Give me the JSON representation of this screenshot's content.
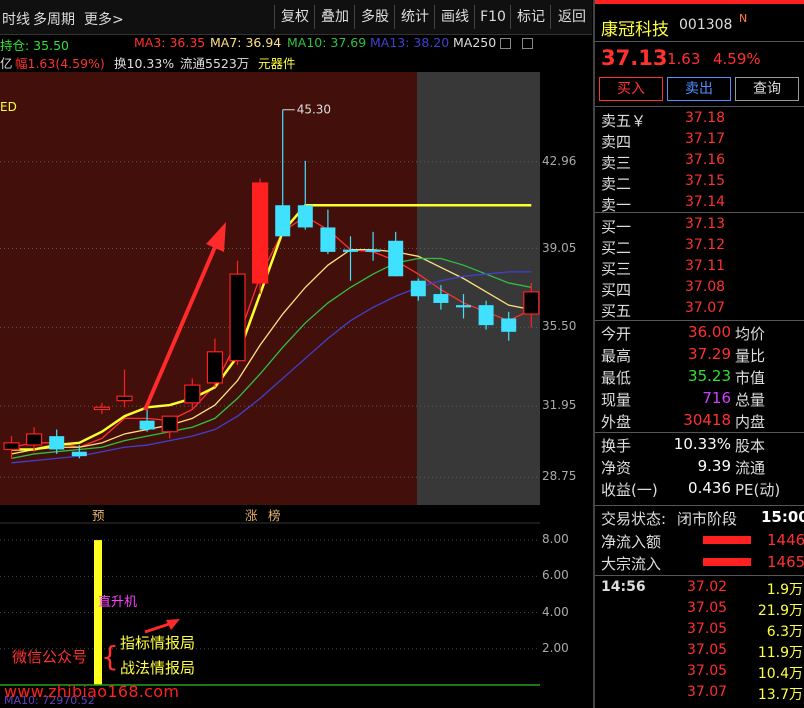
{
  "toolbar": {
    "left_items": [
      "时线",
      "多周期",
      "更多>"
    ],
    "buttons": [
      "复权",
      "叠加",
      "多股",
      "统计",
      "画线",
      "F10",
      "标记",
      "返回"
    ]
  },
  "ma_legend": {
    "hold_label": "持仓: 35.50",
    "ma3": "MA3: 36.35",
    "ma7": "MA7: 36.94",
    "ma10": "MA10: 37.69",
    "ma13": "MA13: 38.20",
    "ma250": "MA250"
  },
  "info_row": {
    "amount": "亿",
    "amplitude": "幅1.63(4.59%)",
    "turnover": "换10.33%",
    "float": "流通5523万",
    "sector": "元器件"
  },
  "chart": {
    "high_label": "45.30",
    "corner_label": "ED",
    "price_axis": [
      "42.96",
      "39.05",
      "35.50",
      "31.95",
      "28.75"
    ],
    "markers": [
      {
        "text": "预",
        "x": 92
      },
      {
        "text": "涨",
        "x": 245
      },
      {
        "text": "榜",
        "x": 268
      }
    ],
    "colors": {
      "up": "#ff2020",
      "down": "#40e0ff",
      "bg_red": "#420f0a",
      "bg_grey": "#383838"
    }
  },
  "chart_data": {
    "type": "candlestick",
    "candles": [
      {
        "o": 30.0,
        "h": 30.6,
        "l": 29.6,
        "c": 30.3
      },
      {
        "o": 30.2,
        "h": 31.0,
        "l": 29.9,
        "c": 30.7
      },
      {
        "o": 30.6,
        "h": 30.9,
        "l": 29.8,
        "c": 30.0
      },
      {
        "o": 29.9,
        "h": 30.2,
        "l": 29.6,
        "c": 29.7
      },
      {
        "o": 31.8,
        "h": 32.1,
        "l": 31.6,
        "c": 31.9
      },
      {
        "o": 32.2,
        "h": 33.6,
        "l": 31.9,
        "c": 32.4
      },
      {
        "o": 31.3,
        "h": 31.8,
        "l": 30.8,
        "c": 30.9
      },
      {
        "o": 30.8,
        "h": 31.5,
        "l": 30.5,
        "c": 31.5
      },
      {
        "o": 32.1,
        "h": 33.2,
        "l": 31.8,
        "c": 32.9
      },
      {
        "o": 33.0,
        "h": 35.0,
        "l": 32.8,
        "c": 34.4
      },
      {
        "o": 34.0,
        "h": 38.5,
        "l": 33.8,
        "c": 37.9
      },
      {
        "o": 37.5,
        "h": 42.2,
        "l": 37.0,
        "c": 42.0
      },
      {
        "o": 41.0,
        "h": 45.3,
        "l": 39.8,
        "c": 39.6
      },
      {
        "o": 41.0,
        "h": 43.0,
        "l": 39.9,
        "c": 40.0
      },
      {
        "o": 40.0,
        "h": 40.8,
        "l": 38.8,
        "c": 38.9
      },
      {
        "o": 39.0,
        "h": 39.6,
        "l": 37.6,
        "c": 38.9
      },
      {
        "o": 39.0,
        "h": 39.8,
        "l": 38.5,
        "c": 38.9
      },
      {
        "o": 39.4,
        "h": 39.8,
        "l": 37.8,
        "c": 37.8
      },
      {
        "o": 37.6,
        "h": 37.7,
        "l": 36.7,
        "c": 36.9
      },
      {
        "o": 37.0,
        "h": 37.4,
        "l": 36.3,
        "c": 36.6
      },
      {
        "o": 36.5,
        "h": 37.0,
        "l": 35.9,
        "c": 36.4
      },
      {
        "o": 36.5,
        "h": 36.7,
        "l": 35.4,
        "c": 35.6
      },
      {
        "o": 35.9,
        "h": 36.2,
        "l": 34.9,
        "c": 35.3
      },
      {
        "o": 36.1,
        "h": 37.5,
        "l": 35.5,
        "c": 37.1
      }
    ],
    "y_range": [
      27.5,
      47.0
    ],
    "ma_lines": [
      {
        "name": "MA3",
        "color": "#ff3030",
        "values": [
          30.1,
          30.3,
          30.3,
          30.1,
          30.5,
          31.4,
          31.4,
          31.3,
          31.8,
          32.9,
          34.9,
          37.8,
          39.8,
          40.5,
          39.9,
          39.0,
          38.9,
          38.5,
          37.9,
          37.2,
          36.6,
          36.2,
          35.8,
          36.3
        ]
      },
      {
        "name": "MA7",
        "color": "#ffe080",
        "values": [
          29.8,
          30.0,
          30.1,
          30.1,
          30.3,
          30.7,
          30.9,
          31.1,
          31.4,
          32.0,
          33.1,
          34.7,
          36.1,
          37.3,
          38.3,
          39.0,
          39.0,
          38.9,
          38.7,
          38.2,
          37.7,
          37.1,
          36.5,
          36.3
        ]
      },
      {
        "name": "MA10",
        "color": "#30c040",
        "values": [
          29.6,
          29.8,
          29.9,
          30.0,
          30.1,
          30.4,
          30.6,
          30.8,
          31.0,
          31.4,
          32.3,
          33.4,
          34.6,
          35.7,
          36.6,
          37.3,
          37.9,
          38.4,
          38.6,
          38.6,
          38.3,
          37.9,
          37.5,
          37.3
        ]
      },
      {
        "name": "MA13",
        "color": "#4040d0",
        "values": [
          29.4,
          29.5,
          29.6,
          29.7,
          29.9,
          30.1,
          30.2,
          30.4,
          30.6,
          30.9,
          31.5,
          32.3,
          33.2,
          34.1,
          35.0,
          35.8,
          36.4,
          36.9,
          37.3,
          37.6,
          37.8,
          37.9,
          38.0,
          38.0
        ]
      }
    ],
    "support_line": {
      "color": "#ffff30",
      "values": [
        30.0,
        30.0,
        30.2,
        30.3,
        30.8,
        31.5,
        31.9,
        32.0,
        32.3,
        32.8,
        34.2,
        37.0,
        39.8,
        41.0,
        41.0,
        41.0,
        41.0,
        41.0,
        41.0,
        41.0,
        41.0,
        41.0,
        41.0,
        41.0
      ]
    }
  },
  "sub_chart": {
    "label": "直升机",
    "axis": [
      "8.00",
      "6.00",
      "4.00",
      "2.00"
    ],
    "legend": "MA10: 72970.52",
    "bar_value": 8.0,
    "bar_color": "#ffff20",
    "y_range": [
      0,
      9
    ]
  },
  "watermark": {
    "wechat": "微信公众号",
    "line1": "指标情报局",
    "line2": "战法情报局",
    "url": "www.zhibiao168.com"
  },
  "quote": {
    "name": "康冠科技",
    "code": "001308",
    "flag": "N",
    "price": "37.13",
    "change": "1.63",
    "pct": "4.59%",
    "buttons": [
      "买入",
      "卖出",
      "查询"
    ]
  },
  "order_book": {
    "asks": [
      {
        "label": "卖五￥",
        "price": "37.18"
      },
      {
        "label": "卖四",
        "price": "37.17"
      },
      {
        "label": "卖三",
        "price": "37.16"
      },
      {
        "label": "卖二",
        "price": "37.15"
      },
      {
        "label": "卖一",
        "price": "37.14"
      }
    ],
    "bids": [
      {
        "label": "买一",
        "price": "37.13"
      },
      {
        "label": "买二",
        "price": "37.12"
      },
      {
        "label": "买三",
        "price": "37.11"
      },
      {
        "label": "买四",
        "price": "37.08"
      },
      {
        "label": "买五",
        "price": "37.07"
      }
    ]
  },
  "stats": [
    {
      "l1": "今开",
      "v": "36.00",
      "c": "#ff3030",
      "l2": "均价"
    },
    {
      "l1": "最高",
      "v": "37.29",
      "c": "#ff3030",
      "l2": "量比"
    },
    {
      "l1": "最低",
      "v": "35.23",
      "c": "#30e030",
      "l2": "市值"
    },
    {
      "l1": "现量",
      "v": "716",
      "c": "#d040ff",
      "l2": "总量"
    },
    {
      "l1": "外盘",
      "v": "30418",
      "c": "#ff3030",
      "l2": "内盘"
    }
  ],
  "stats2": [
    {
      "l1": "换手",
      "v": "10.33%",
      "c": "#ffffff",
      "l2": "股本"
    },
    {
      "l1": "净资",
      "v": "9.39",
      "c": "#ffffff",
      "l2": "流通"
    },
    {
      "l1": "收益(一)",
      "v": "0.436",
      "c": "#ffffff",
      "l2": "PE(动)"
    }
  ],
  "status": {
    "label": "交易状态:",
    "value": "闭市阶段",
    "time": "15:00"
  },
  "flows": [
    {
      "label": "净流入额",
      "value": "1446"
    },
    {
      "label": "大宗流入",
      "value": "1465"
    }
  ],
  "ticks": [
    {
      "t": "14:56",
      "px": "37.02",
      "vol": "1.9万"
    },
    {
      "t": "",
      "px": "37.05",
      "vol": "21.9万"
    },
    {
      "t": "",
      "px": "37.05",
      "vol": "6.3万"
    },
    {
      "t": "",
      "px": "37.05",
      "vol": "11.9万"
    },
    {
      "t": "",
      "px": "37.05",
      "vol": "10.4万"
    },
    {
      "t": "",
      "px": "37.07",
      "vol": "13.7万"
    }
  ]
}
